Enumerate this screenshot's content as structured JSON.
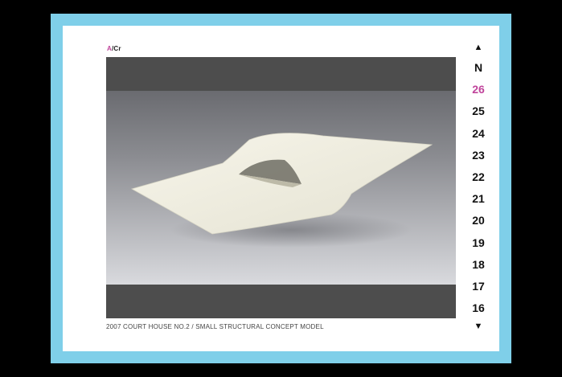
{
  "logo": {
    "a": "A",
    "rest": "/Cr"
  },
  "caption": "2007 COURT HOUSE NO.2 / SMALL STRUCTURAL CONCEPT MODEL",
  "nav": {
    "up_icon": "triangle-up-icon",
    "down_icon": "triangle-down-icon",
    "up_glyph": "▲",
    "down_glyph": "▼",
    "items": [
      "N",
      "26",
      "25",
      "24",
      "23",
      "22",
      "21",
      "20",
      "19",
      "18",
      "17",
      "16"
    ],
    "active": "26"
  },
  "colors": {
    "frame": "#7fcfe9",
    "accent": "#c0449b",
    "photo_bar": "#4d4d4d"
  },
  "photo": {
    "subject": "paper-model-image"
  }
}
